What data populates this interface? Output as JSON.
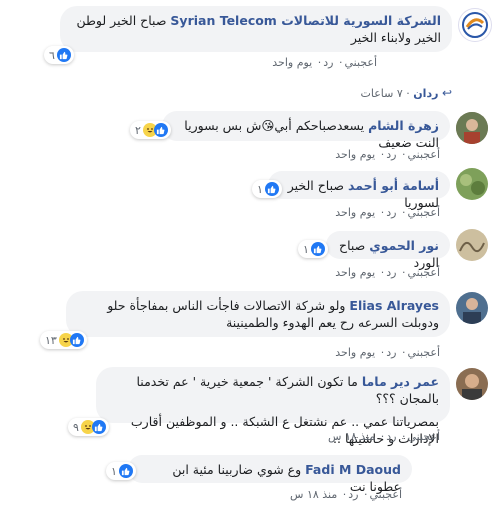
{
  "comments": [
    {
      "author": "الشركة السورية للاتصالات Syrian Telecom",
      "text": "صباح الخير لوطن الخير ولابناء الخير",
      "reaction_count": "٦",
      "like": "أعجبني",
      "reply": "رد",
      "time": "يوم واحد"
    },
    {
      "author": "زهرة الشام",
      "text": "يسعدصباحكم أبي😘ش بس بسوريا النت ضعيف",
      "reaction_count": "٢",
      "like": "أعجبني",
      "reply": "رد",
      "time": "يوم واحد"
    },
    {
      "author": "أسامة أبو أحمد",
      "text": "صباح الخير لسوريا",
      "reaction_count": "١",
      "like": "أعجبني",
      "reply": "رد",
      "time": "يوم واحد"
    },
    {
      "author": "نور الحموي",
      "text": "صباح الورد",
      "reaction_count": "١",
      "like": "أعجبني",
      "reply": "رد",
      "time": "يوم واحد"
    },
    {
      "author": "Elias Alrayes",
      "text": "ولو شركة الاتصالات فاجأت الناس بمفاجأة حلو ودوبلت السرعه رح يعم الهدوء والطمينينة",
      "reaction_count": "١٣",
      "like": "أعجبني",
      "reply": "رد",
      "time": "يوم واحد"
    },
    {
      "author": "عمر دير ماما",
      "text1": "ما تكون الشركة ' جمعية خيرية ' عم تخدمنا بالمجان ؟؟؟",
      "text2": "بمصرياتنا عمي .. عم نشتغل ع الشبكة .. و الموظفين أقارب الإدارات و حاشيتها ..",
      "reaction_count": "٩",
      "like": "أعجبني",
      "reply": "رد",
      "time": "منذ ١٨ س"
    },
    {
      "author": "Fadi M Daoud",
      "text": "وع شوي ضاربينا مئية ابن عطونا نت",
      "reaction_count": "١",
      "like": "أعجبني",
      "reply": "رد",
      "time": "منذ ١٨ س"
    }
  ],
  "reply_summary": {
    "author": "ردان",
    "time": "٧ ساعات"
  },
  "colors": {
    "name": "#385898",
    "bubble": "#f2f3f5",
    "like": "#2078f4",
    "haha": "#f7d44a"
  }
}
